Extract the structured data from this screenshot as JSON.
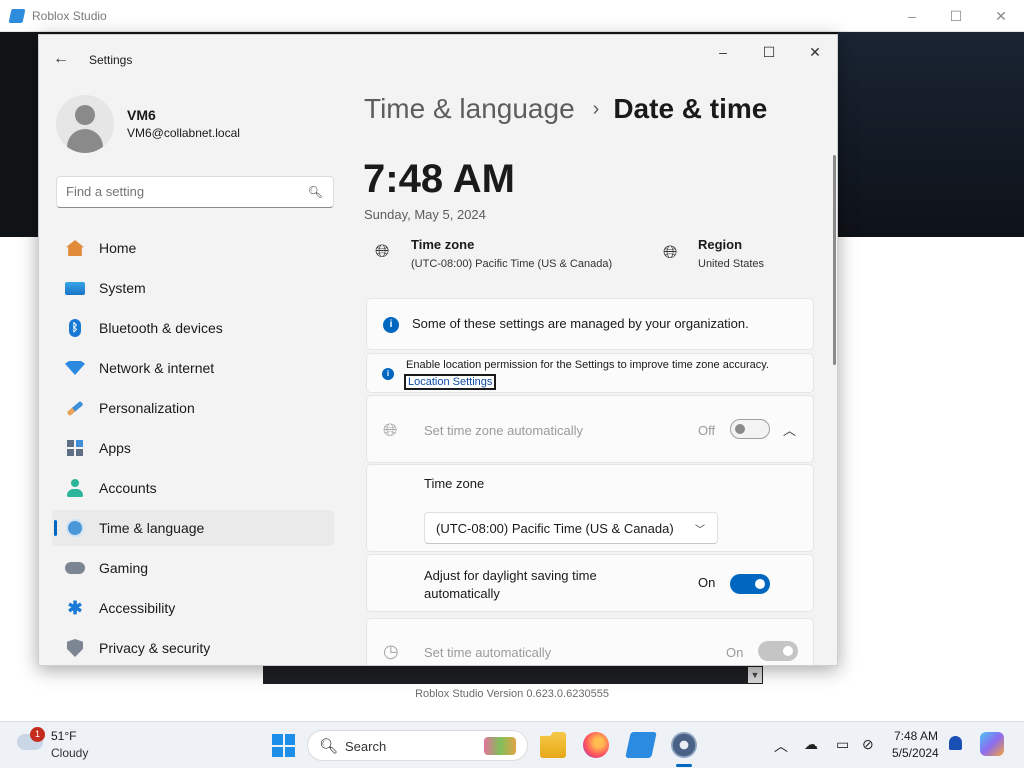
{
  "background_app": {
    "title": "Roblox Studio",
    "version_text": "Roblox Studio Version 0.623.0.6230555"
  },
  "settings": {
    "window_title": "Settings",
    "user": {
      "name": "VM6",
      "email": "VM6@collabnet.local"
    },
    "search": {
      "placeholder": "Find a setting"
    },
    "nav": [
      {
        "label": "Home",
        "icon": "home-icon"
      },
      {
        "label": "System",
        "icon": "system-icon"
      },
      {
        "label": "Bluetooth & devices",
        "icon": "bluetooth-icon"
      },
      {
        "label": "Network & internet",
        "icon": "wifi-icon"
      },
      {
        "label": "Personalization",
        "icon": "brush-icon"
      },
      {
        "label": "Apps",
        "icon": "apps-icon"
      },
      {
        "label": "Accounts",
        "icon": "account-icon"
      },
      {
        "label": "Time & language",
        "icon": "globe-clock-icon",
        "active": true
      },
      {
        "label": "Gaming",
        "icon": "gamepad-icon"
      },
      {
        "label": "Accessibility",
        "icon": "accessibility-icon"
      },
      {
        "label": "Privacy & security",
        "icon": "shield-icon"
      }
    ],
    "breadcrumb": {
      "parent": "Time & language",
      "separator": "›",
      "current": "Date & time"
    },
    "current_time": "7:48 AM",
    "current_date": "Sunday, May 5, 2024",
    "time_zone": {
      "title": "Time zone",
      "value": "(UTC-08:00) Pacific Time (US & Canada)"
    },
    "region": {
      "title": "Region",
      "value": "United States"
    },
    "managed_notice": "Some of these settings are managed by your organization.",
    "location_notice": {
      "text": "Enable location permission for the Settings to improve time zone accuracy.",
      "link": "Location Settings"
    },
    "set_time_zone_auto": {
      "label": "Set time zone automatically",
      "state": "Off"
    },
    "time_zone_section": {
      "label": "Time zone",
      "selected": "(UTC-08:00) Pacific Time (US & Canada)"
    },
    "daylight_saving": {
      "label": "Adjust for daylight saving time automatically",
      "state": "On"
    },
    "set_time_auto": {
      "label": "Set time automatically",
      "state": "On"
    }
  },
  "taskbar": {
    "weather": {
      "temp": "51°F",
      "desc": "Cloudy",
      "badge": "1"
    },
    "search_label": "Search",
    "clock": {
      "time": "7:48 AM",
      "date": "5/5/2024"
    }
  },
  "colors": {
    "accent": "#0067c0",
    "badge": "#c42b1c"
  }
}
